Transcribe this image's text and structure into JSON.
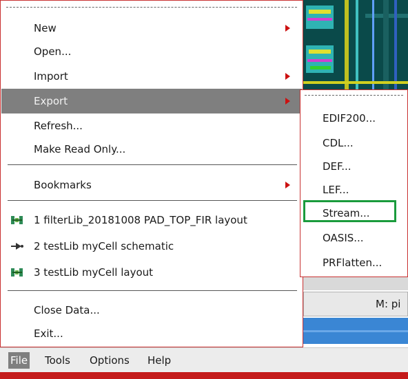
{
  "file_menu": {
    "items": [
      {
        "label": "New"
      },
      {
        "label": "Open..."
      },
      {
        "label": "Import"
      },
      {
        "label": "Export"
      },
      {
        "label": "Refresh..."
      },
      {
        "label": "Make Read Only..."
      },
      {
        "label": "Bookmarks"
      },
      {
        "label": "1 filterLib_20181008  PAD_TOP_FIR  layout"
      },
      {
        "label": "2 testLib  myCell  schematic"
      },
      {
        "label": "3 testLib  myCell  layout"
      },
      {
        "label": "Close Data..."
      },
      {
        "label": "Exit..."
      }
    ]
  },
  "export_submenu": {
    "items": [
      {
        "label": "EDIF200..."
      },
      {
        "label": "CDL..."
      },
      {
        "label": "DEF..."
      },
      {
        "label": "LEF..."
      },
      {
        "label": "Stream..."
      },
      {
        "label": "OASIS..."
      },
      {
        "label": "PRFlatten..."
      }
    ],
    "highlighted": "Stream..."
  },
  "background": {
    "mode_label": "M: pi"
  },
  "menubar": {
    "items": [
      {
        "label": "File"
      },
      {
        "label": "Tools"
      },
      {
        "label": "Options"
      },
      {
        "label": "Help"
      }
    ],
    "active": "File"
  },
  "colors": {
    "menu_border": "#c83030",
    "highlight": "#7f7f7f",
    "submenu_arrow": "#cc1111",
    "annotation_box": "#1a9b3c"
  }
}
